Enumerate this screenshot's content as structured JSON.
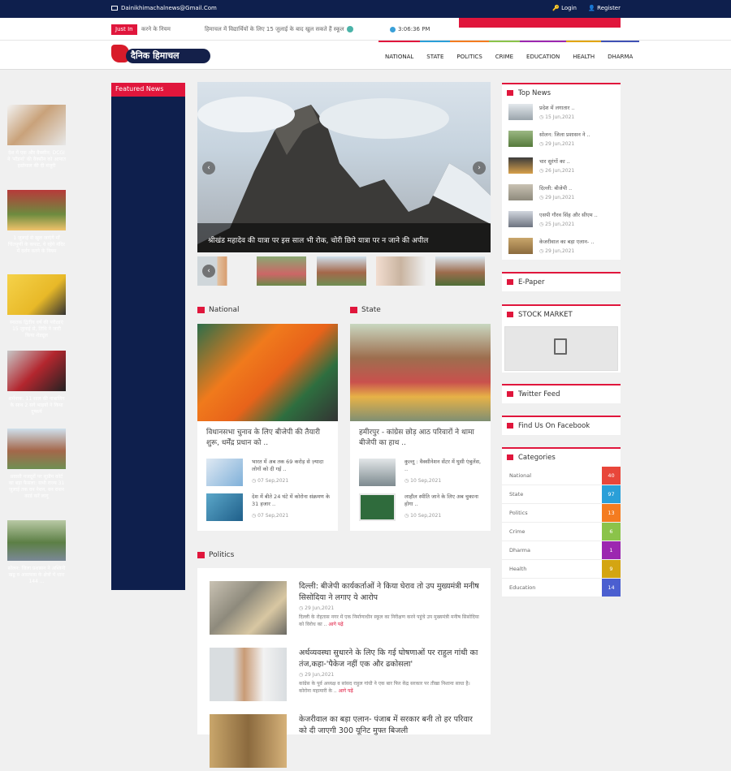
{
  "topbar": {
    "email": "Dainikhimachalnews@Gmail.Com",
    "login": "Login",
    "register": "Register"
  },
  "ticker": {
    "label": "Just In",
    "item1": "करने के नियम",
    "item2": "हिमाचल में विद्यार्थियों के लिए 15 जुलाई के बाद खुल सकते हैं स्कूल",
    "time": "3:06:36 PM"
  },
  "logo": {
    "text": "दैनिक हिमाचल"
  },
  "nav": [
    "NATIONAL",
    "STATE",
    "POLITICS",
    "CRIME",
    "EDUCATION",
    "HEALTH",
    "DHARMA"
  ],
  "nav_colors": [
    "#e0163c",
    "#2a9fd8",
    "#f47c20",
    "#8bc34a",
    "#9c27b0",
    "#e2a500",
    "#3f51b5"
  ],
  "featured": {
    "title": "Featured News",
    "items": [
      "देश में एक और वैक्सीन: DCGI ने 'मॉडर्ना' की वैक्सीन को आपात इस्तेमाल की दी मंजूरी",
      "1 जुलाई से खुल जाएंगे माँ चिंतपूर्णी के कपाट, ये रहेंगे मंदिर में दर्शन करने के नियम",
      "स्नातक द्वितीय वर्ष की परीक्षाएं 15 जुलाई से, तिथि ने जारी किया शेड्यूल",
      "शर्मनाक: 11 साल की नाबालिग के साथ 2 सगे भाइयों ने किया दुष्कर्म",
      "प्रवासी मजदूरों पर सुप्रीम कोर्ट का बड़ा फैसला: सभी राज्य 31 जुलाई तक वन नेशन, वन राशन कार्ड करें लागू",
      "सोलन: जिला प्रशासन ने अश्विनी खड्ड व आसपास के क्षेत्रों में धारा 144 ..."
    ]
  },
  "slider": {
    "caption": "श्रीखंड महादेव की यात्रा पर इस साल भी रोक, चोरी छिपे यात्रा पर न जाने की अपील"
  },
  "national": {
    "title": "National",
    "headline": "विधानसभा चुनाव के लिए बीजेपी की तैयारी शुरू, धर्मेंद्र प्रधान को ..",
    "subs": [
      {
        "text": "भारत में अब तक 69 करोड़ से ज़्यादा लोगों को दी गई ..",
        "date": "07 Sep,2021"
      },
      {
        "text": "देश में बीते 24 घंटे में कोरोना संक्रमण के 31 हजार ..",
        "date": "07 Sep,2021"
      }
    ]
  },
  "state": {
    "title": "State",
    "headline": "हमीरपुर - कांग्रेस छोड़ आठ परिवारों ने थामा बीजेपी का हाथ ..",
    "subs": [
      {
        "text": "कुल्लू : वैक्सीनेशन सेंटर में घुसी एंबुलेंस, ..",
        "date": "10 Sep,2021"
      },
      {
        "text": "लाहौल स्पीति जाने के लिए अब चुकाना होगा ..",
        "date": "10 Sep,2021"
      }
    ]
  },
  "top_news": {
    "title": "Top News",
    "items": [
      {
        "text": "प्रदेश में लगातार ..",
        "date": "15 Jun,2021"
      },
      {
        "text": "सोलन: जिला प्रशासन ने ..",
        "date": "29 Jun,2021"
      },
      {
        "text": "चार सुरंगों का ..",
        "date": "26 Jun,2021"
      },
      {
        "text": "दिल्ली: बीजेपी ..",
        "date": "29 Jun,2021"
      },
      {
        "text": "एसपी गौरव सिंह और सीएम ..",
        "date": "25 Jun,2021"
      },
      {
        "text": "केजरीवाल का बड़ा एलान- ..",
        "date": "29 Jun,2021"
      }
    ]
  },
  "widgets": {
    "epaper": "E-Paper",
    "stock": "STOCK MARKET",
    "twitter": "Twitter Feed",
    "facebook": "Find Us On Facebook",
    "categories": "Categories"
  },
  "categories": [
    {
      "name": "National",
      "count": "40",
      "color": "#e8463a"
    },
    {
      "name": "State",
      "count": "97",
      "color": "#2a9fd8"
    },
    {
      "name": "Politics",
      "count": "13",
      "color": "#f47c20"
    },
    {
      "name": "Crime",
      "count": "6",
      "color": "#8bc34a"
    },
    {
      "name": "Dharma",
      "count": "1",
      "color": "#9c27b0"
    },
    {
      "name": "Health",
      "count": "9",
      "color": "#d4a512"
    },
    {
      "name": "Education",
      "count": "14",
      "color": "#4b5fd0"
    }
  ],
  "politics": {
    "title": "Politics",
    "items": [
      {
        "title": "दिल्ली: बीजेपी कार्यकर्ताओं ने किया घेराव तो उप मुख्यमंत्री मनीष सिसोदिया ने लगाए ये आरोप",
        "date": "29 Jun,2021",
        "excerpt": "दिल्ली के रोहतास नगर में एक निर्माणाधीन स्कूल का निरीक्षण करने पहुंचे उप मुख्यमंत्री मनीष सिसोदिया को विरोध का ..",
        "more": "आगे पढ़ें"
      },
      {
        "title": "अर्थव्यवस्था सुधारने के लिए कि गई घोषणाओं पर राहुल गांधी का तंज,कहा-'पैकेज नहीं एक और ढकोसला'",
        "date": "29 Jun,2021",
        "excerpt": "कांग्रेस के पूर्व अध्यक्ष व सांसद राहुल गांधी ने एक बार फिर केंद्र सरकार पर तीखा निशाना साधा है। कोरोना महामारी के ..",
        "more": "आगे पढ़ें"
      },
      {
        "title": "केजरीवाल का बड़ा एलान- पंजाब में सरकार बनी तो हर परिवार को दी जाएगी 300 यूनिट मुफ्त बिजली",
        "date": "",
        "excerpt": "",
        "more": ""
      }
    ]
  }
}
